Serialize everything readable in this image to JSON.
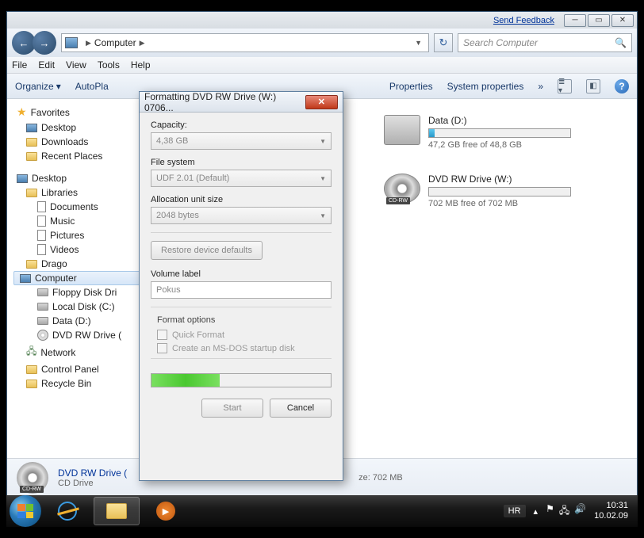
{
  "titlebar": {
    "feedback": "Send Feedback"
  },
  "nav": {
    "crumb": "Computer",
    "search_placeholder": "Search Computer"
  },
  "menu": {
    "file": "File",
    "edit": "Edit",
    "view": "View",
    "tools": "Tools",
    "help": "Help"
  },
  "toolbar": {
    "organize": "Organize",
    "autoplay": "AutoPla",
    "properties": "Properties",
    "system_properties": "System properties",
    "more": "»"
  },
  "sidebar": {
    "favorites": "Favorites",
    "desktop": "Desktop",
    "downloads": "Downloads",
    "recent": "Recent Places",
    "desktop2": "Desktop",
    "libraries": "Libraries",
    "documents": "Documents",
    "music": "Music",
    "pictures": "Pictures",
    "videos": "Videos",
    "drago": "Drago",
    "computer": "Computer",
    "floppy": "Floppy Disk Dri",
    "localc": "Local Disk (C:)",
    "datad": "Data (D:)",
    "dvdrw": "DVD RW Drive (",
    "network": "Network",
    "cpanel": "Control Panel",
    "recycle": "Recycle Bin"
  },
  "drives": {
    "data": {
      "name": "Data (D:)",
      "stat": "47,2 GB free of 48,8 GB",
      "fill_pct": 4
    },
    "dvd": {
      "name": "DVD RW Drive (W:)",
      "stat": "702 MB free of 702 MB",
      "fill_pct": 0,
      "badge": "CD-RW"
    }
  },
  "details": {
    "name": "DVD RW Drive (",
    "type": "CD Drive",
    "size_label": "ze: 702 MB",
    "badge": "CD-RW"
  },
  "modal": {
    "title": "Formatting DVD RW Drive (W:) 0706...",
    "capacity_label": "Capacity:",
    "capacity_value": "4,38 GB",
    "fs_label": "File system",
    "fs_value": "UDF 2.01 (Default)",
    "aus_label": "Allocation unit size",
    "aus_value": "2048 bytes",
    "restore": "Restore device defaults",
    "vol_label": "Volume label",
    "vol_value": "Pokus",
    "options_label": "Format options",
    "quick": "Quick Format",
    "msdos": "Create an MS-DOS startup disk",
    "start": "Start",
    "cancel": "Cancel",
    "progress_pct": 38
  },
  "taskbar": {
    "lang": "HR",
    "time": "10:31",
    "date": "10.02.09"
  }
}
